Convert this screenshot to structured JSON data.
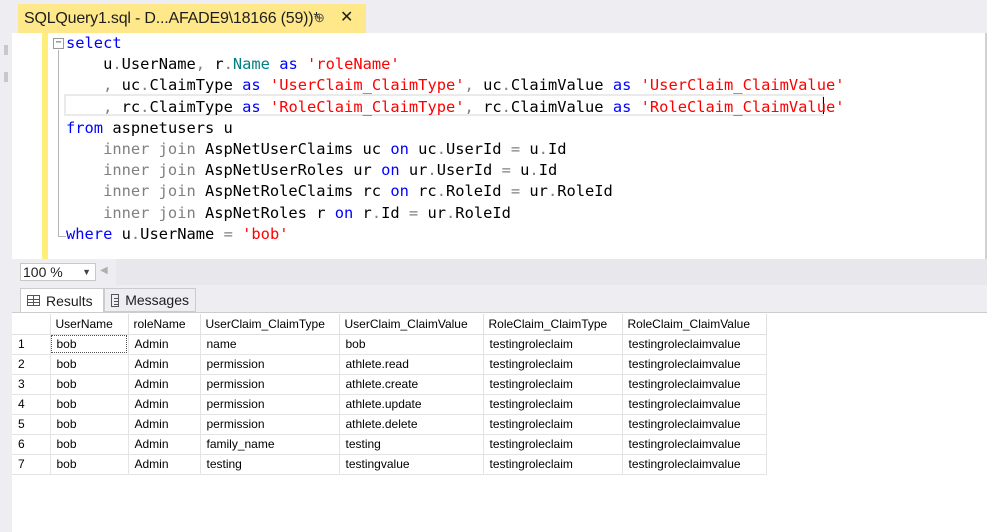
{
  "tab": {
    "title": "SQLQuery1.sql - D...AFADE9\\18166 (59))*",
    "pin_icon": "⊕",
    "close_icon": "✕"
  },
  "editor": {
    "lines": [
      [
        {
          "t": "select",
          "c": "kw"
        }
      ],
      [
        {
          "t": "    u",
          "c": "blk"
        },
        {
          "t": ".",
          "c": "gray"
        },
        {
          "t": "UserName",
          "c": "blk"
        },
        {
          "t": ", ",
          "c": "gray"
        },
        {
          "t": "r",
          "c": "blk"
        },
        {
          "t": ".",
          "c": "gray"
        },
        {
          "t": "Name",
          "c": "teal"
        },
        {
          "t": " as ",
          "c": "kw"
        },
        {
          "t": "'roleName'",
          "c": "str"
        }
      ],
      [
        {
          "t": "    , ",
          "c": "gray"
        },
        {
          "t": "uc",
          "c": "blk"
        },
        {
          "t": ".",
          "c": "gray"
        },
        {
          "t": "ClaimType",
          "c": "blk"
        },
        {
          "t": " as ",
          "c": "kw"
        },
        {
          "t": "'UserClaim_ClaimType'",
          "c": "str"
        },
        {
          "t": ", ",
          "c": "gray"
        },
        {
          "t": "uc",
          "c": "blk"
        },
        {
          "t": ".",
          "c": "gray"
        },
        {
          "t": "ClaimValue",
          "c": "blk"
        },
        {
          "t": " as ",
          "c": "kw"
        },
        {
          "t": "'UserClaim_ClaimValue'",
          "c": "str"
        }
      ],
      [
        {
          "t": "    , ",
          "c": "gray"
        },
        {
          "t": "rc",
          "c": "blk"
        },
        {
          "t": ".",
          "c": "gray"
        },
        {
          "t": "ClaimType",
          "c": "blk"
        },
        {
          "t": " as ",
          "c": "kw"
        },
        {
          "t": "'RoleClaim_ClaimType'",
          "c": "str"
        },
        {
          "t": ", ",
          "c": "gray"
        },
        {
          "t": "rc",
          "c": "blk"
        },
        {
          "t": ".",
          "c": "gray"
        },
        {
          "t": "ClaimValue",
          "c": "blk"
        },
        {
          "t": " as ",
          "c": "kw"
        },
        {
          "t": "'RoleClaim_ClaimValue'",
          "c": "str"
        }
      ],
      [
        {
          "t": "from",
          "c": "kw"
        },
        {
          "t": " aspnetusers u",
          "c": "blk"
        }
      ],
      [
        {
          "t": "    inner join",
          "c": "gray"
        },
        {
          "t": " AspNetUserClaims uc ",
          "c": "blk"
        },
        {
          "t": "on",
          "c": "kw"
        },
        {
          "t": " uc",
          "c": "blk"
        },
        {
          "t": ".",
          "c": "gray"
        },
        {
          "t": "UserId ",
          "c": "blk"
        },
        {
          "t": "=",
          "c": "gray"
        },
        {
          "t": " u",
          "c": "blk"
        },
        {
          "t": ".",
          "c": "gray"
        },
        {
          "t": "Id",
          "c": "blk"
        }
      ],
      [
        {
          "t": "    inner join",
          "c": "gray"
        },
        {
          "t": " AspNetUserRoles ur ",
          "c": "blk"
        },
        {
          "t": "on",
          "c": "kw"
        },
        {
          "t": " ur",
          "c": "blk"
        },
        {
          "t": ".",
          "c": "gray"
        },
        {
          "t": "UserId ",
          "c": "blk"
        },
        {
          "t": "=",
          "c": "gray"
        },
        {
          "t": " u",
          "c": "blk"
        },
        {
          "t": ".",
          "c": "gray"
        },
        {
          "t": "Id",
          "c": "blk"
        }
      ],
      [
        {
          "t": "    inner join",
          "c": "gray"
        },
        {
          "t": " AspNetRoleClaims rc ",
          "c": "blk"
        },
        {
          "t": "on",
          "c": "kw"
        },
        {
          "t": " rc",
          "c": "blk"
        },
        {
          "t": ".",
          "c": "gray"
        },
        {
          "t": "RoleId ",
          "c": "blk"
        },
        {
          "t": "=",
          "c": "gray"
        },
        {
          "t": " ur",
          "c": "blk"
        },
        {
          "t": ".",
          "c": "gray"
        },
        {
          "t": "RoleId",
          "c": "blk"
        }
      ],
      [
        {
          "t": "    inner join",
          "c": "gray"
        },
        {
          "t": " AspNetRoles r ",
          "c": "blk"
        },
        {
          "t": "on",
          "c": "kw"
        },
        {
          "t": " r",
          "c": "blk"
        },
        {
          "t": ".",
          "c": "gray"
        },
        {
          "t": "Id ",
          "c": "blk"
        },
        {
          "t": "=",
          "c": "gray"
        },
        {
          "t": " ur",
          "c": "blk"
        },
        {
          "t": ".",
          "c": "gray"
        },
        {
          "t": "RoleId",
          "c": "blk"
        }
      ],
      [
        {
          "t": "where",
          "c": "kw"
        },
        {
          "t": " u",
          "c": "blk"
        },
        {
          "t": ".",
          "c": "gray"
        },
        {
          "t": "UserName ",
          "c": "blk"
        },
        {
          "t": "=",
          "c": "gray"
        },
        {
          "t": " ",
          "c": "blk"
        },
        {
          "t": "'bob'",
          "c": "str"
        }
      ]
    ],
    "collapse_icon": "−"
  },
  "zoom": {
    "value": "100 %",
    "arrow_icon": "▼",
    "scroll_left_icon": "◀"
  },
  "results_tabs": {
    "results_label": "Results",
    "messages_label": "Messages"
  },
  "grid": {
    "columns": [
      "",
      "UserName",
      "roleName",
      "UserClaim_ClaimType",
      "UserClaim_ClaimValue",
      "RoleClaim_ClaimType",
      "RoleClaim_ClaimValue"
    ],
    "rows": [
      [
        "1",
        "bob",
        "Admin",
        "name",
        "bob",
        "testingroleclaim",
        "testingroleclaimvalue"
      ],
      [
        "2",
        "bob",
        "Admin",
        "permission",
        "athlete.read",
        "testingroleclaim",
        "testingroleclaimvalue"
      ],
      [
        "3",
        "bob",
        "Admin",
        "permission",
        "athlete.create",
        "testingroleclaim",
        "testingroleclaimvalue"
      ],
      [
        "4",
        "bob",
        "Admin",
        "permission",
        "athlete.update",
        "testingroleclaim",
        "testingroleclaimvalue"
      ],
      [
        "5",
        "bob",
        "Admin",
        "permission",
        "athlete.delete",
        "testingroleclaim",
        "testingroleclaimvalue"
      ],
      [
        "6",
        "bob",
        "Admin",
        "family_name",
        "testing",
        "testingroleclaim",
        "testingroleclaimvalue"
      ],
      [
        "7",
        "bob",
        "Admin",
        "testing",
        "testingvalue",
        "testingroleclaim",
        "testingroleclaimvalue"
      ]
    ]
  }
}
